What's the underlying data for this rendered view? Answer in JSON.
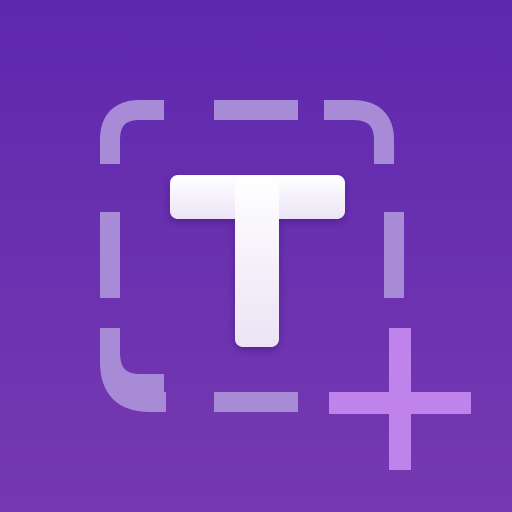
{
  "icon": {
    "name": "add-text-icon",
    "glyph": "T",
    "badge": "plus",
    "colors": {
      "background_top": "#5e28ae",
      "background_bottom": "#7639b1",
      "frame": "#a78bd6",
      "letter_top": "#ffffff",
      "letter_bottom": "#ece4f6",
      "plus": "#c083ec"
    }
  }
}
